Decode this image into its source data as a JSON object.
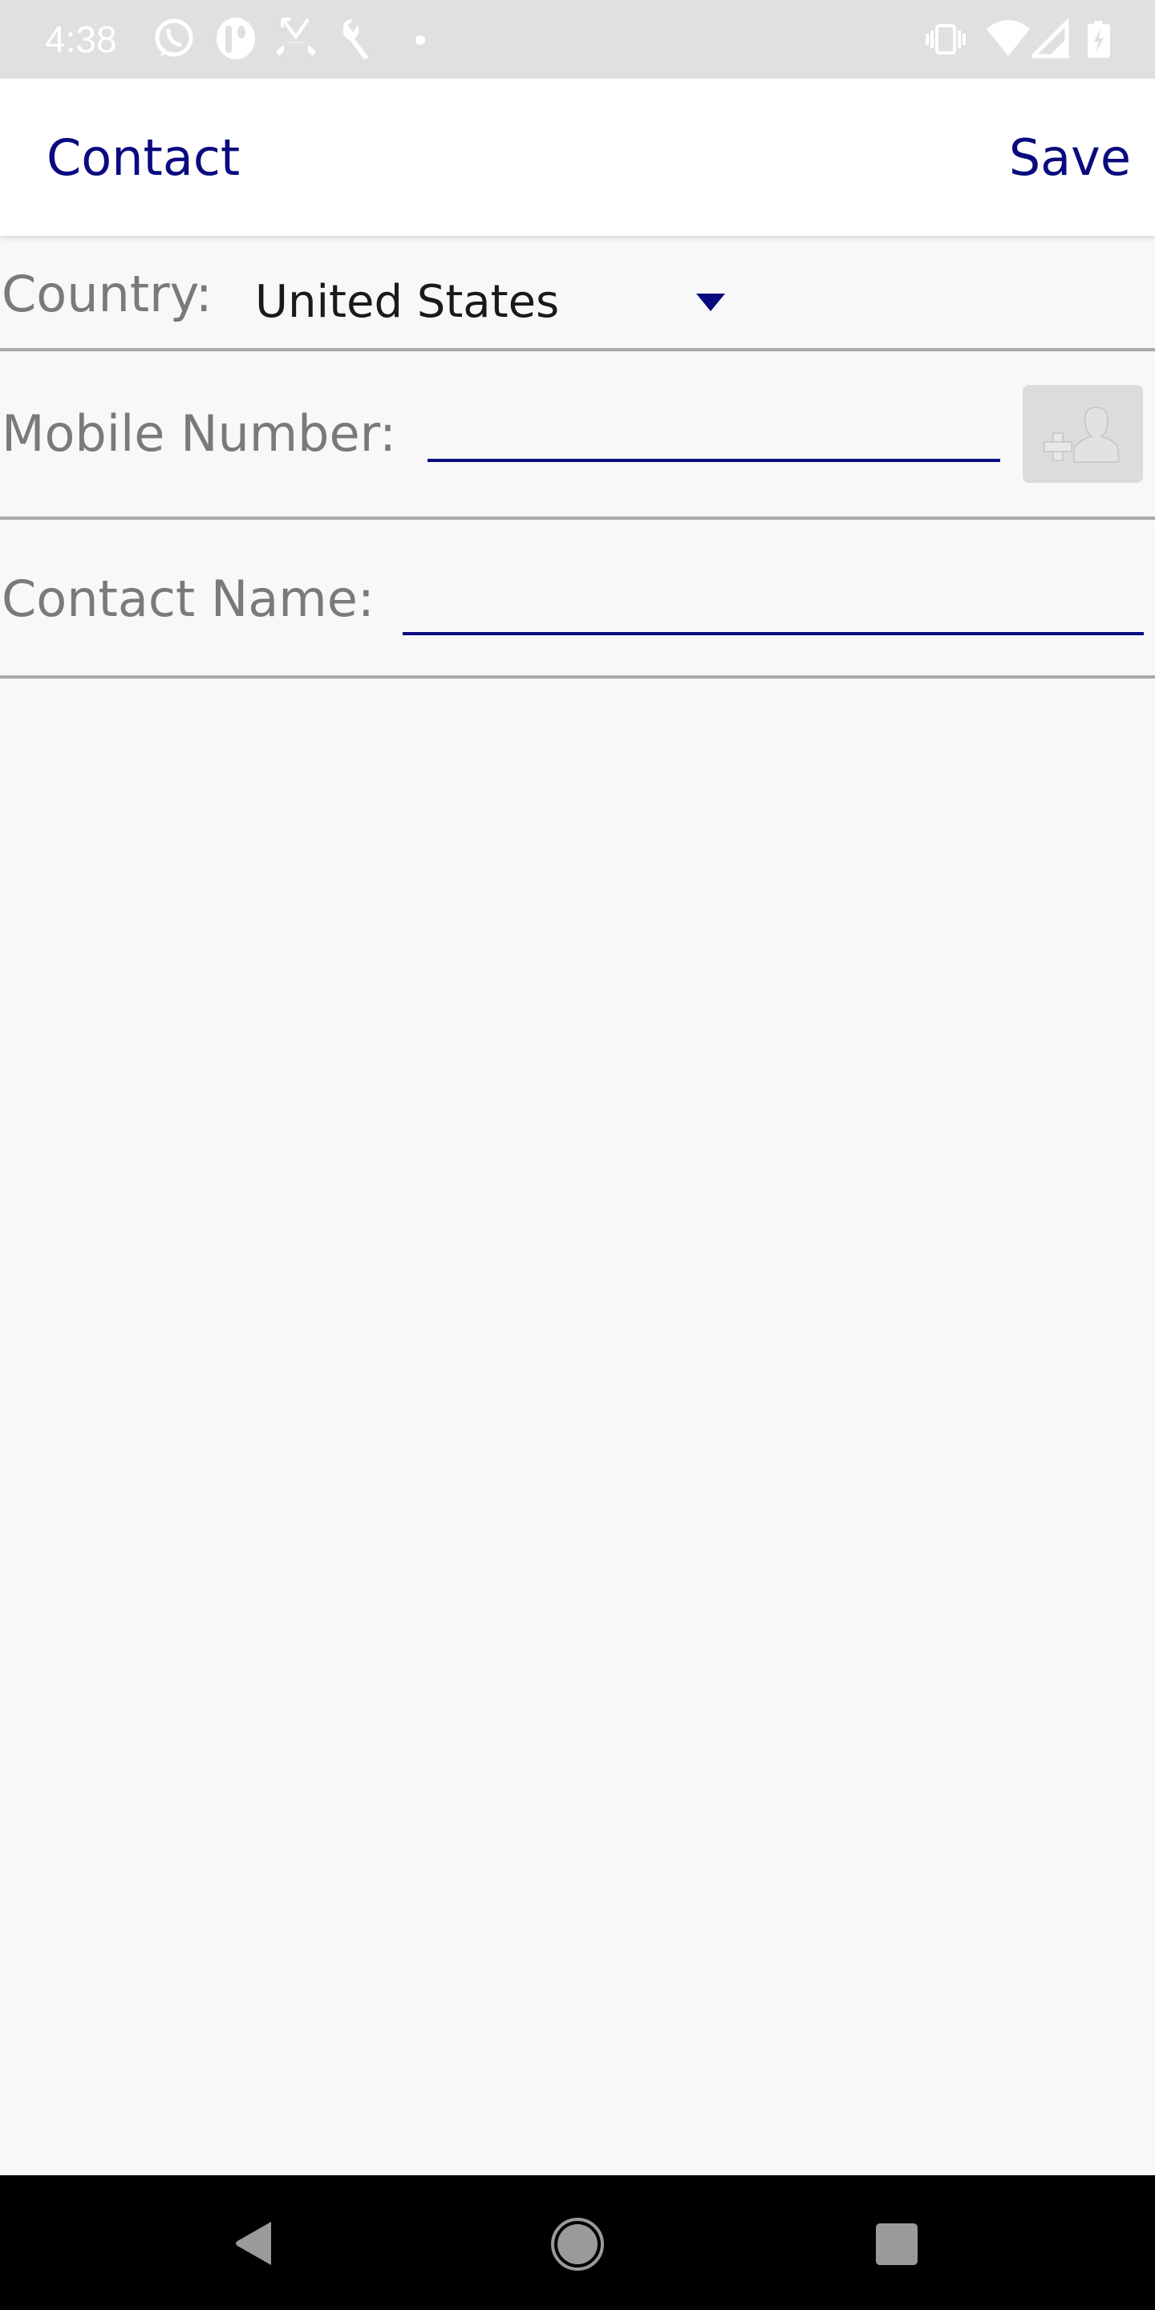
{
  "status_bar": {
    "time": "4:38",
    "left_icons": [
      "whatsapp-icon",
      "app-icon",
      "missed-call-icon",
      "wrench-icon",
      "dot-icon"
    ],
    "right_icons": [
      "vibrate-icon",
      "wifi-icon",
      "signal-icon",
      "battery-charging-icon"
    ]
  },
  "app_bar": {
    "title": "Contact",
    "save_label": "Save"
  },
  "form": {
    "country": {
      "label": "Country:",
      "selected": "United States"
    },
    "mobile_number": {
      "label": "Mobile Number:",
      "value": "",
      "picker_icon": "add-contact-icon"
    },
    "contact_name": {
      "label": "Contact Name:",
      "value": ""
    }
  },
  "nav_bar": {
    "buttons": [
      "back",
      "home",
      "recents"
    ]
  },
  "colors": {
    "accent": "#0a0a80",
    "label": "#7a7a7a",
    "divider": "#aaaaaa",
    "background": "#f8f8f8",
    "status_bar": "#e0e0e0"
  }
}
